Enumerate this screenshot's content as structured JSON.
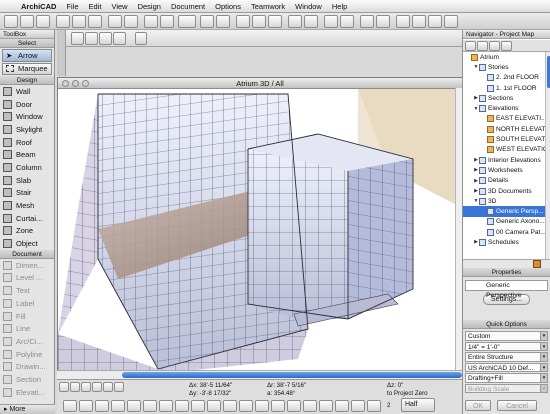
{
  "menubar": {
    "app": "ArchiCAD",
    "items": [
      "File",
      "Edit",
      "View",
      "Design",
      "Document",
      "Options",
      "Teamwork",
      "Window",
      "Help"
    ]
  },
  "toolbox": {
    "title": "ToolBox",
    "select_head": "Select",
    "arrow": "Arrow",
    "marquee": "Marquee",
    "design_head": "Design",
    "design_tools": [
      "Wall",
      "Door",
      "Window",
      "Skylight",
      "Roof",
      "Beam",
      "Column",
      "Slab",
      "Stair",
      "Mesh",
      "Curtai...",
      "Zone",
      "Object"
    ],
    "document_head": "Document",
    "document_tools": [
      "Dimen...",
      "Level ...",
      "Text",
      "Label",
      "Fill",
      "Line",
      "Arc/Ci...",
      "Polyline",
      "Drawin...",
      "Section",
      "Elevati..."
    ],
    "more": "More"
  },
  "window3d": {
    "title": "Atrium 3D / All"
  },
  "coords": {
    "dx": "Δx: 38'-5 11/64\"",
    "dy": "Δy: -3'-8 17/32\"",
    "dr": "Δr: 38'-7 5/16\"",
    "a": "a: 354.48°",
    "dz": "Δz: 0\"",
    "to_project_zero": "to Project Zero",
    "scale": "Half",
    "zero": "2"
  },
  "navigator": {
    "title": "Navigator - Project Map",
    "tree": [
      {
        "label": "Atrium",
        "level": 0,
        "icon": "house"
      },
      {
        "label": "Stories",
        "level": 1,
        "icon": "folder",
        "open": true
      },
      {
        "label": "2. 2nd FLOOR",
        "level": 2,
        "icon": "story"
      },
      {
        "label": "1. 1st FLOOR",
        "level": 2,
        "icon": "story"
      },
      {
        "label": "Sections",
        "level": 1,
        "icon": "folder"
      },
      {
        "label": "Elevations",
        "level": 1,
        "icon": "folder",
        "open": true
      },
      {
        "label": "EAST ELEVATI...",
        "level": 2,
        "icon": "house"
      },
      {
        "label": "NORTH ELEVATI...",
        "level": 2,
        "icon": "house"
      },
      {
        "label": "SOUTH ELEVATI...",
        "level": 2,
        "icon": "house"
      },
      {
        "label": "WEST ELEVATIO...",
        "level": 2,
        "icon": "house"
      },
      {
        "label": "Interior Elevations",
        "level": 1,
        "icon": "folder"
      },
      {
        "label": "Worksheets",
        "level": 1,
        "icon": "folder"
      },
      {
        "label": "Details",
        "level": 1,
        "icon": "folder"
      },
      {
        "label": "3D Documents",
        "level": 1,
        "icon": "folder"
      },
      {
        "label": "3D",
        "level": 1,
        "icon": "folder",
        "open": true
      },
      {
        "label": "Generic Persp...",
        "level": 2,
        "icon": "camera",
        "selected": true
      },
      {
        "label": "Generic Axono...",
        "level": 2,
        "icon": "camera"
      },
      {
        "label": "00 Camera Pat...",
        "level": 2,
        "icon": "camera"
      },
      {
        "label": "Schedules",
        "level": 1,
        "icon": "folder"
      }
    ]
  },
  "properties": {
    "title": "Properties",
    "value": "Generic Perspective",
    "settings": "Settings..."
  },
  "quick_options": {
    "title": "Quick Options",
    "rows": [
      "Custom",
      "1/4\"  =  1'-0\"",
      "Entire Structure",
      "US ArchiCAD 10 Def...",
      "Drafting+Fill",
      "Building Scale"
    ]
  },
  "dialog_buttons": {
    "ok": "OK",
    "cancel": "Cancel"
  }
}
